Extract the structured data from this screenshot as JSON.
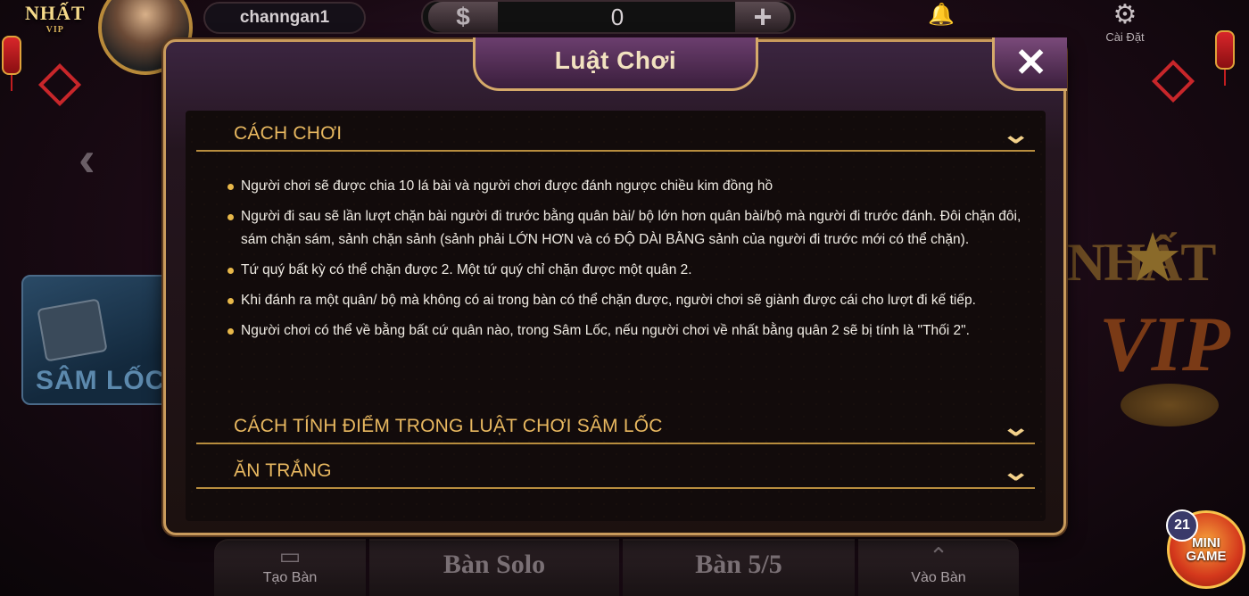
{
  "header": {
    "logo": "NHẤT",
    "logo_sub": "VIP",
    "username": "channgan1",
    "currency_symbol": "$",
    "balance": "0",
    "add_symbol": "+",
    "settings_label": "Cài Đặt"
  },
  "lobby": {
    "left_game": "SÂM LỐC",
    "brand_top": "NHẤT",
    "brand_bottom": "VIP"
  },
  "modal": {
    "title": "Luật Chơi",
    "sections": [
      {
        "label": "CÁCH CHƠI",
        "expanded": true,
        "items": [
          "Người chơi sẽ được chia 10 lá bài và người chơi được đánh ngược chiều kim đồng hồ",
          "Người đi sau sẽ lần lượt chặn bài người đi trước bằng quân bài/ bộ lớn hơn quân bài/bộ mà người đi trước đánh. Đôi chặn đôi, sám chặn sám, sảnh chặn sảnh (sảnh phải LỚN HƠN và có ĐỘ DÀI BẰNG sảnh của người đi trước mới có thể chặn).",
          "Tứ quý bất kỳ có thể chặn được 2. Một tứ quý chỉ chặn được một quân 2.",
          "Khi đánh ra một quân/ bộ mà không có ai trong bàn có thể chặn được, người chơi sẽ giành được cái cho lượt đi kế tiếp.",
          "Người chơi có thể về bằng bất cứ quân nào, trong Sâm Lốc, nếu người chơi về nhất bằng quân 2 sẽ bị tính là \"Thối 2\"."
        ]
      },
      {
        "label": "CÁCH TÍNH ĐIỂM TRONG LUẬT CHƠI SÂM LỐC",
        "expanded": false
      },
      {
        "label": "ĂN TRẮNG",
        "expanded": false
      }
    ]
  },
  "bottom": {
    "create_table": "Tạo Bàn",
    "solo_table": "Bàn Solo",
    "table_5": "Bàn 5/5",
    "join_table": "Vào Bàn"
  },
  "mini_game": {
    "badge": "21",
    "line1": "MINI",
    "line2": "GAME"
  },
  "colors": {
    "accent_gold": "#e8b860",
    "modal_border": "#c99b5c",
    "title_tab": "#6b3e6e"
  }
}
